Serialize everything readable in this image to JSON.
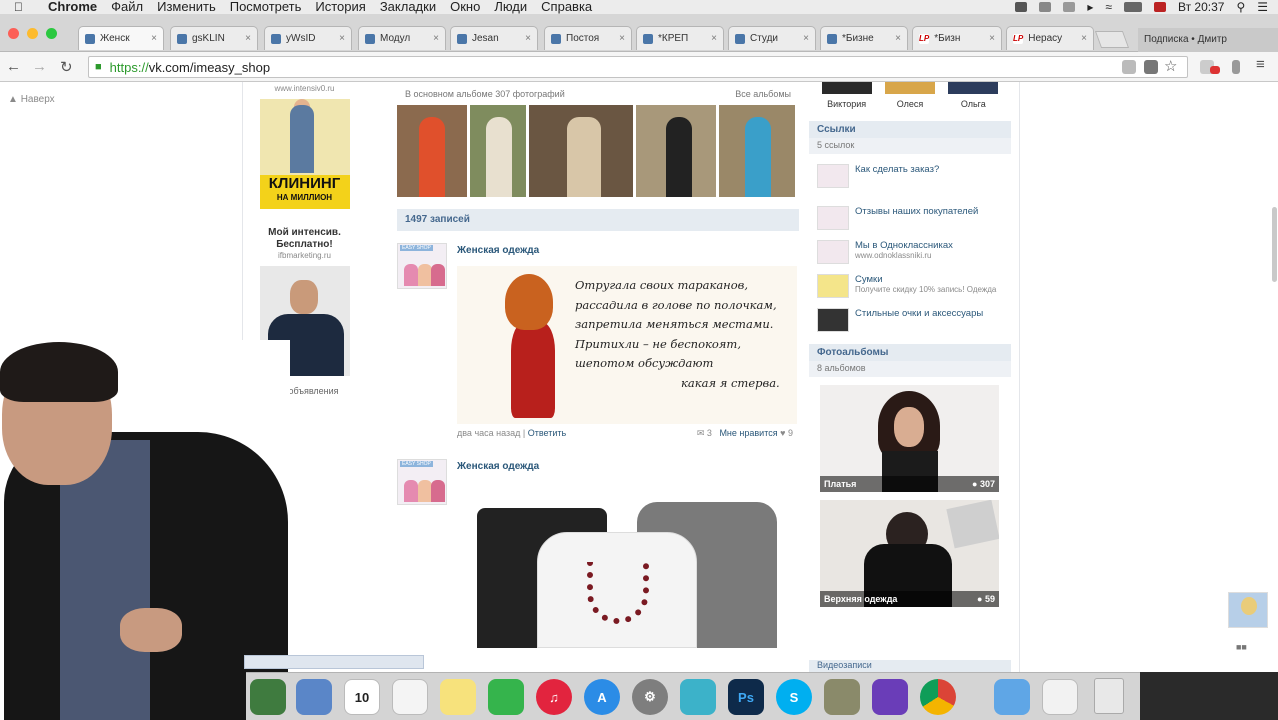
{
  "menubar": {
    "app": "Chrome",
    "items": [
      "Файл",
      "Изменить",
      "Посмотреть",
      "История",
      "Закладки",
      "Окно",
      "Люди",
      "Справка"
    ],
    "clock": "Вт 20:37"
  },
  "tabs": [
    {
      "label": "Женск",
      "active": true
    },
    {
      "label": "gsKLIN"
    },
    {
      "label": "yWsID"
    },
    {
      "label": "Модул"
    },
    {
      "label": "Jesan"
    },
    {
      "label": "Постоя"
    },
    {
      "label": "*КРЕП"
    },
    {
      "label": "Студи"
    },
    {
      "label": "*Бизне"
    },
    {
      "label": "*Бизн"
    },
    {
      "label": "Нерасу"
    }
  ],
  "profile_tab": "Подписка • Дмитр",
  "address": {
    "scheme": "https://",
    "url": "vk.com/imeasy_shop"
  },
  "page": {
    "back_link": "Наверх",
    "left_ads": {
      "site_top": "www.intensiv0.ru",
      "promo_title": "КЛИНИНГ",
      "promo_subtitle": "НА МИЛЛИОН",
      "promo_text_1": "Мой интенсив.",
      "promo_text_2": "Бесплатно!",
      "promo_site": "ifbmarketing.ru",
      "all_ads": "Все объявления"
    },
    "album": {
      "caption": "В основном альбоме 307 фотографий",
      "all_albums": "Все альбомы"
    },
    "posts_count": "1497 записей",
    "posts": [
      {
        "author": "Женская одежда",
        "avatar_tag": "EASY SHOP",
        "quote": [
          "Отругала своих тараканов,",
          "рассадила в голове по полочкам,",
          "запретила меняться местами.",
          "Притихли – не беспокоят,",
          "шепотом обсуждают",
          "какая я стерва."
        ],
        "time": "два часа назад",
        "reply": "Ответить",
        "comments": "3",
        "likes_label": "Мне нравится",
        "likes": "9"
      },
      {
        "author": "Женская одежда",
        "avatar_tag": "EASY SHOP"
      }
    ],
    "friends": [
      {
        "name": "Виктория"
      },
      {
        "name": "Олеся"
      },
      {
        "name": "Ольга"
      }
    ],
    "links": {
      "title": "Ссылки",
      "count": "5 ссылок",
      "items": [
        {
          "label": "Как сделать заказ?",
          "desc": ""
        },
        {
          "label": "Отзывы наших покупателей",
          "desc": ""
        },
        {
          "label": "Мы в Одноклассниках",
          "desc": "www.odnoklassniki.ru"
        },
        {
          "label": "Сумки",
          "desc": "Получите скидку 10% запись! Одежда"
        },
        {
          "label": "Стильные очки и аксессуары",
          "desc": ""
        }
      ]
    },
    "photo_albums": {
      "title": "Фотоальбомы",
      "count": "8 альбомов",
      "items": [
        {
          "name": "Платья",
          "count": "307"
        },
        {
          "name": "Верхняя одежда",
          "count": "59"
        }
      ]
    },
    "bottom_block_title": "Видеозаписи"
  },
  "dock": {
    "calendar_day": "10",
    "apps": [
      "finder-icon",
      "preview-icon",
      "calendar-icon",
      "reminders-icon",
      "notes-icon",
      "facetime-icon",
      "itunes-icon",
      "appstore-icon",
      "system-preferences-icon",
      "ftp-icon",
      "photoshop-icon",
      "skype-icon",
      "cleaner-icon",
      "screenshot-icon",
      "chrome-icon",
      "folder-icon",
      "mail-preview-icon",
      "trash-icon"
    ],
    "photoshop_label": "Ps",
    "skype_label": "S"
  },
  "colors": {
    "vk_blue": "#45688e",
    "vk_link": "#2b587a",
    "header_bg": "#e5ebf1",
    "secure_green": "#2c9a2c"
  }
}
